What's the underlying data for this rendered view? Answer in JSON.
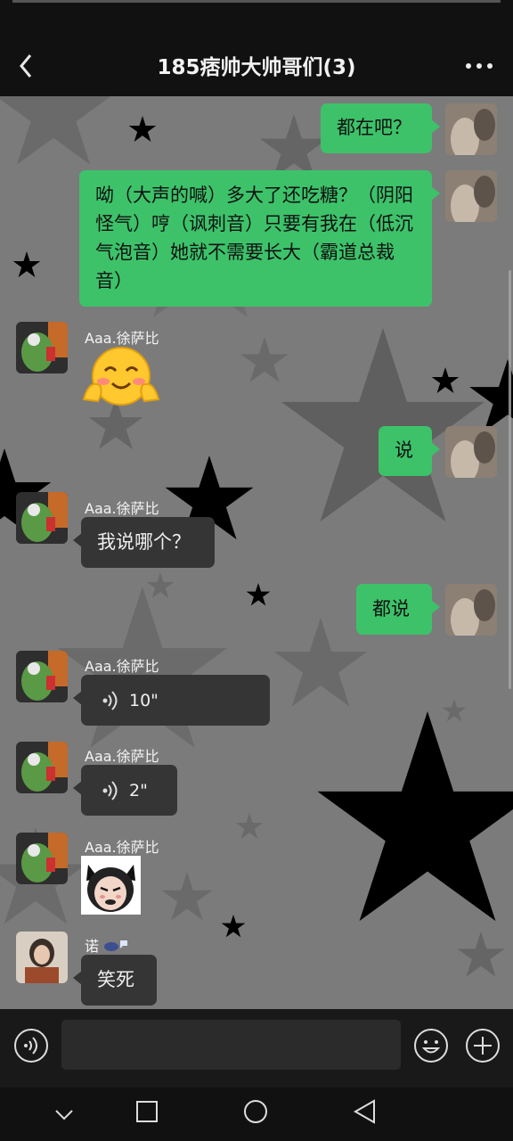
{
  "header": {
    "title": "185痞帅大帅哥们(3)"
  },
  "messages": [
    {
      "text": "都在吧？"
    },
    {
      "text": "呦（大声的喊）多大了还吃糖？（阴阳怪气）哼（讽刺音）只要有我在（低沉气泡音）她就不需要长大（霸道总裁音）"
    },
    {
      "name": "Aaa.徐萨比"
    },
    {
      "text": "说"
    },
    {
      "name": "Aaa.徐萨比",
      "text": "我说哪个？"
    },
    {
      "text": "都说"
    },
    {
      "name": "Aaa.徐萨比",
      "duration": "10\""
    },
    {
      "name": "Aaa.徐萨比",
      "duration": "2\""
    },
    {
      "name": "Aaa.徐萨比"
    },
    {
      "name": "诺",
      "text": "笑死"
    }
  ]
}
